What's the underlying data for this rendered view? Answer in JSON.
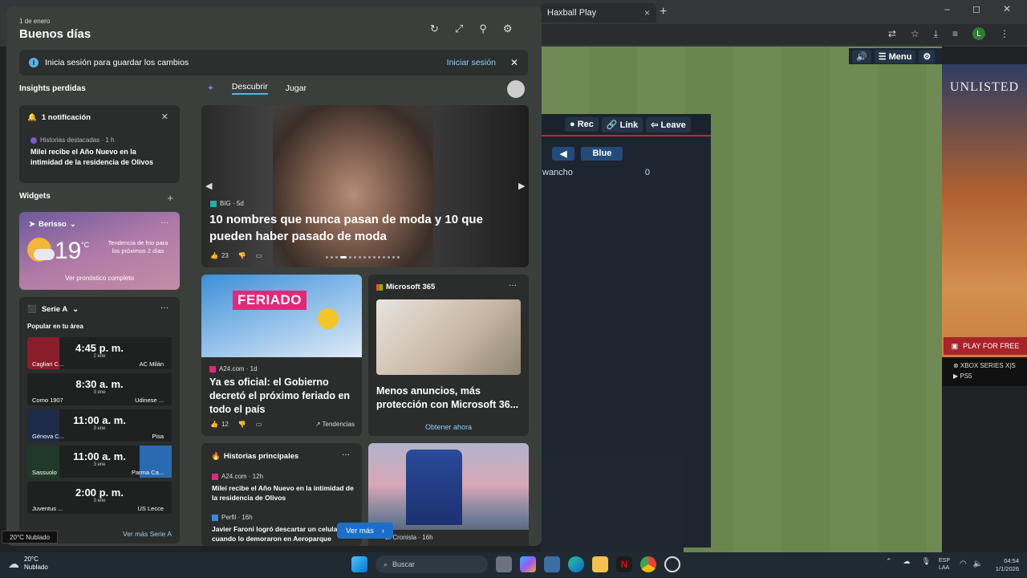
{
  "browser": {
    "tab_title": "Haxball Play",
    "tab_close": "×",
    "new_tab": "+",
    "window_controls": [
      "–",
      "◻",
      "✕"
    ],
    "profile_initial": "L"
  },
  "game": {
    "toolbar": {
      "sound": "🔊",
      "menu": "☰ Menu",
      "settings": "⚙"
    },
    "room_buttons": {
      "rec": "● Rec",
      "link": "🔗 Link",
      "leave": "⇦ Leave"
    },
    "team_arrow": "◀",
    "team_name": "Blue",
    "player": {
      "name": "wancho",
      "score": "0"
    }
  },
  "ad": {
    "logo": "UNLISTED",
    "cta": "PLAY FOR FREE",
    "platforms": [
      "⊗ XBOX SERIES X|S",
      "▶ PS5"
    ]
  },
  "widgets": {
    "date": "1 de enero",
    "greeting": "Buenos días",
    "signin_banner": {
      "text": "Inicia sesión para guardar los cambios",
      "link": "Iniciar sesión"
    },
    "insights_title": "Insights perdidas",
    "notification": {
      "title": "1 notificación",
      "source": "Historias destacadas · 1 h",
      "headline": "Milei recibe el Año Nuevo en la intimidad de la residencia de Olivos"
    },
    "widgets_title": "Widgets",
    "weather": {
      "location": "Berisso",
      "temp": "19",
      "unit": "°C",
      "trend": "Tendencia de frío para los próximos 2 días",
      "link": "Ver pronóstico completo"
    },
    "serie_a": {
      "title": "Serie A",
      "subtitle": "Popular en tu área",
      "matches": [
        {
          "home": "Cagliari C...",
          "away": "AC Milán",
          "time": "4:45 p. m.",
          "date": "2 ene",
          "home_color": "#8a1d2a",
          "away_color": "#1f2120"
        },
        {
          "home": "Como 1907",
          "away": "Udinese ...",
          "time": "8:30 a. m.",
          "date": "3 ene",
          "home_color": "#1f2120",
          "away_color": "#1f2120"
        },
        {
          "home": "Génova C...",
          "away": "Pisa",
          "time": "11:00 a. m.",
          "date": "3 ene",
          "home_color": "#1d2a4a",
          "away_color": "#1f2120"
        },
        {
          "home": "Sassuolo",
          "away": "Parma Ca...",
          "time": "11:00 a. m.",
          "date": "3 ene",
          "home_color": "#1f3a2a",
          "away_color": "#2a6ab0"
        },
        {
          "home": "Juventus ...",
          "away": "US Lecce",
          "time": "2:00 p. m.",
          "date": "3 ene",
          "home_color": "#1f2120",
          "away_color": "#1f2120"
        }
      ],
      "more_link": "Ver más Serie A"
    },
    "tabs": [
      "Descubrir",
      "Jugar"
    ],
    "hero": {
      "source": "BIG · 5d",
      "title": "10 nombres que nunca pasan de moda y 10 que pueden haber pasado de moda",
      "likes": "23"
    },
    "feriado": {
      "image_label": "FERIADO",
      "source": "A24.com · 1d",
      "title": "Ya es oficial: el Gobierno decretó el próximo feriado en todo el país",
      "likes": "12",
      "trend": "Tendencias"
    },
    "microsoft": {
      "brand": "Microsoft 365",
      "title": "Menos anuncios, más protección con Microsoft 36...",
      "cta": "Obtener ahora"
    },
    "historias": {
      "title": "Historias principales",
      "items": [
        {
          "source": "A24.com · 12h",
          "headline": "Milei recibe el Año Nuevo en la intimidad de la residencia de Olivos"
        },
        {
          "source": "Perfil · 16h",
          "headline": "Javier Faroni logró descartar un celular cuando lo demoraron en Aeroparque"
        }
      ]
    },
    "train": {
      "source": "El Cronista · 16h"
    },
    "ver_mas": "Ver más"
  },
  "taskbar": {
    "tooltip": "20°C Nublado",
    "weather_temp": "20°C",
    "weather_cond": "Nublado",
    "search": "Buscar",
    "lang_top": "ESP",
    "lang_bottom": "LAA",
    "time": "04:54",
    "date": "1/1/2026"
  }
}
